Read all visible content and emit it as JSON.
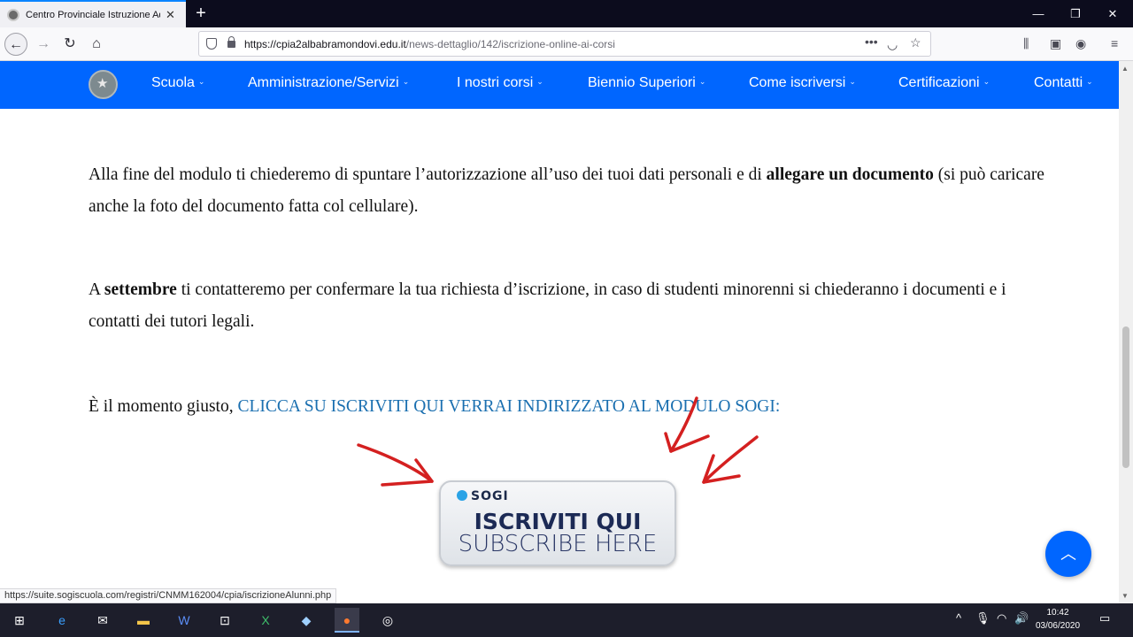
{
  "browser": {
    "tab_title": "Centro Provinciale Istruzione Adulti",
    "tab_close": "✕",
    "new_tab": "+",
    "url_host": "https://cpia2albabramondovi.edu.it",
    "url_path": "/news-dettaglio/142/iscrizione-online-ai-corsi",
    "status_url": "https://suite.sogiscuola.com/registri/CNMM162004/cpia/iscrizioneAlunni.php"
  },
  "sitenav": {
    "items": [
      {
        "label": "Scuola"
      },
      {
        "label": "Amministrazione/Servizi"
      },
      {
        "label": "I nostri corsi"
      },
      {
        "label": "Biennio Superiori"
      },
      {
        "label": "Come iscriversi"
      },
      {
        "label": "Certificazioni"
      },
      {
        "label": "Contatti"
      }
    ],
    "chevron": "⌄"
  },
  "content": {
    "p1_a": "Alla fine del modulo ti chiederemo di spuntare l’autorizzazione all’uso dei tuoi dati personali e di ",
    "p1_bold": "allegare un documento",
    "p1_b": " (si può caricare anche la foto del documento fatta col cellulare).",
    "p2_a": "A ",
    "p2_bold": "settembre",
    "p2_b": " ti contatteremo per confermare la tua richiesta d’iscrizione, in caso di studenti minorenni si chiederanno i documenti e i contatti dei tutori legali.",
    "p3_a": "È il momento giusto, ",
    "p3_link": "CLICCA SU ISCRIVITI QUI VERRAI INDIRIZZATO AL MODULO SOGI:"
  },
  "sogi_button": {
    "logo": "SOGI",
    "line1": "ISCRIVITI QUI",
    "line2": "SUBSCRIBE HERE"
  },
  "taskbar": {
    "time": "10:42",
    "date": "03/06/2020"
  },
  "colors": {
    "site_accent": "#0066ff",
    "link": "#1a6fb0",
    "annotation_arrows": "#d42020"
  }
}
